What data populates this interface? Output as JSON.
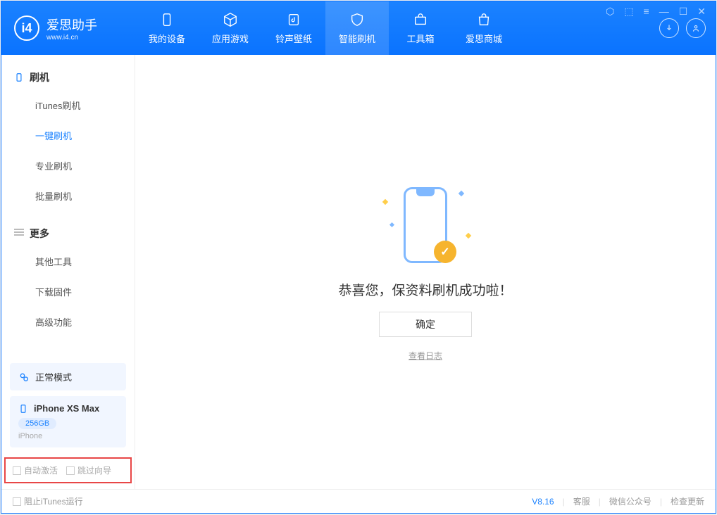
{
  "app": {
    "title": "爱思助手",
    "url": "www.i4.cn"
  },
  "nav": [
    {
      "label": "我的设备"
    },
    {
      "label": "应用游戏"
    },
    {
      "label": "铃声壁纸"
    },
    {
      "label": "智能刷机"
    },
    {
      "label": "工具箱"
    },
    {
      "label": "爱思商城"
    }
  ],
  "sidebar": {
    "group1_title": "刷机",
    "group1_items": [
      "iTunes刷机",
      "一键刷机",
      "专业刷机",
      "批量刷机"
    ],
    "group2_title": "更多",
    "group2_items": [
      "其他工具",
      "下载固件",
      "高级功能"
    ]
  },
  "mode_label": "正常模式",
  "device": {
    "name": "iPhone XS Max",
    "capacity": "256GB",
    "type": "iPhone"
  },
  "options": {
    "auto_activate": "自动激活",
    "skip_guide": "跳过向导"
  },
  "main": {
    "success_text": "恭喜您，保资料刷机成功啦！",
    "ok_button": "确定",
    "view_log": "查看日志"
  },
  "status": {
    "block_itunes": "阻止iTunes运行",
    "version": "V8.16",
    "support": "客服",
    "wechat": "微信公众号",
    "check_update": "检查更新"
  }
}
